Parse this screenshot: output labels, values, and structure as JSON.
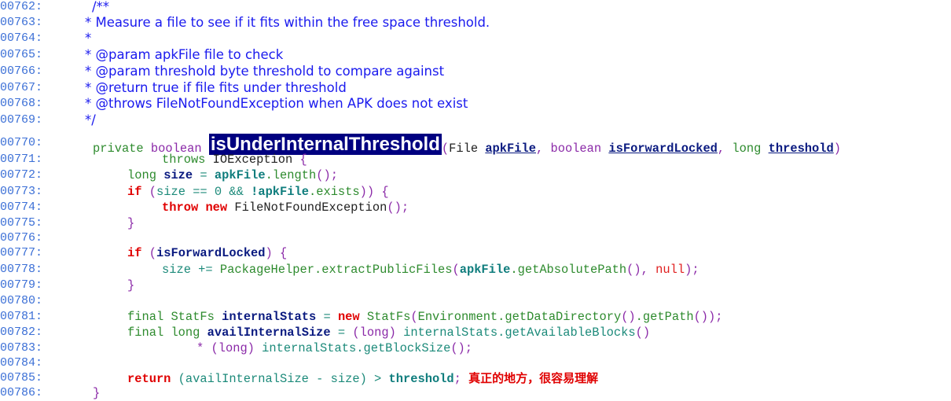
{
  "viewer": {
    "line_numbers": [
      "00762:",
      "00763:",
      "00764:",
      "00765:",
      "00766:",
      "00767:",
      "00768:",
      "00769:",
      "00770:",
      "00771:",
      "00772:",
      "00773:",
      "00774:",
      "00775:",
      "00776:",
      "00777:",
      "00778:",
      "00779:",
      "00780:",
      "00781:",
      "00782:",
      "00783:",
      "00784:",
      "00785:",
      "00786:"
    ],
    "doc": {
      "open": "/**",
      "l763": "* Measure a file to see if it fits within the free space threshold.",
      "l764": "*",
      "l765": "* @param apkFile file to check",
      "l766": "* @param threshold byte threshold to compare against",
      "l767": "* @return true if file fits under threshold",
      "l768": "* @throws FileNotFoundException when APK does not exist",
      "close": "*/"
    },
    "code": {
      "private": "private",
      "boolean": "boolean",
      "method_name": "isUnderInternalThreshold",
      "open_paren": "(",
      "File": "File",
      "apkFile": "apkFile",
      "comma": ",",
      "isForwardLocked": "isForwardLocked",
      "long": "long",
      "threshold": "threshold",
      "close_paren": ")",
      "throws": "throws",
      "IOException": "IOException",
      "brace_open": "{",
      "brace_close": "}",
      "size": "size",
      "eq": "=",
      "length_call": ".length",
      "parens_semi": "();",
      "if": "if",
      "size_plain": "size",
      "eq_zero": "== 0 &&",
      "not_apk": "!apkFile",
      "exists": ".exists",
      "close_brace_line": ")) {",
      "throw": "throw",
      "new": "new",
      "fnfe": "FileNotFoundException",
      "size_plus": "size +=",
      "pkg_helper": "PackageHelper.extractPublicFiles",
      "get_abs": ".getAbsolutePath",
      "null": "null",
      "final": "final",
      "StatFs": "StatFs",
      "internalStats": "internalStats",
      "statfs_ctor": "StatFs",
      "env_call": "Environment.getDataDirectory",
      "get_path": ".getPath",
      "availInternalSize": "availInternalSize",
      "long_cast": "(long)",
      "get_avail_blocks": "internalStats.getAvailableBlocks",
      "times": "*",
      "get_block_size": "internalStats.getBlockSize",
      "return": "return",
      "return_expr": "(availInternalSize - size) >",
      "semicolon": ";"
    },
    "annotation": "真正的地方，很容易理解"
  }
}
